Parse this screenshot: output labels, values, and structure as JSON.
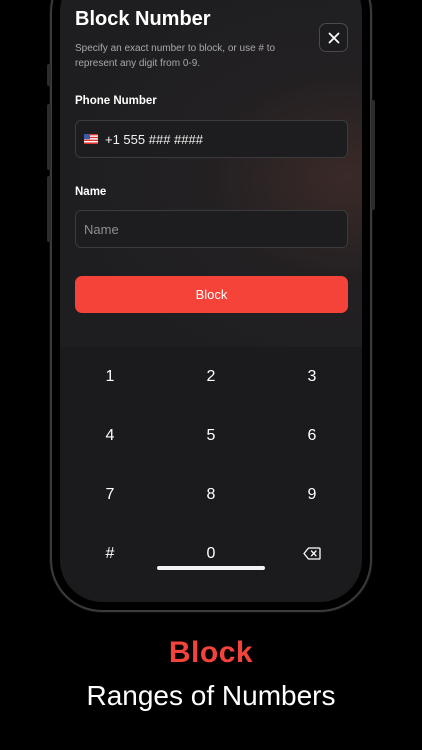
{
  "form": {
    "title": "Block Number",
    "subtitle": "Specify an exact number to block, or use # to represent any digit from 0-9.",
    "phone_label": "Phone Number",
    "phone_value": "+1 555 ### ####",
    "name_label": "Name",
    "name_placeholder": "Name",
    "name_value": "",
    "block_button": "Block"
  },
  "keypad": {
    "keys": [
      "1",
      "2",
      "3",
      "4",
      "5",
      "6",
      "7",
      "8",
      "9",
      "#",
      "0",
      "backspace"
    ]
  },
  "caption": {
    "headline": "Block",
    "subline": "Ranges of Numbers"
  },
  "colors": {
    "accent": "#f5433a",
    "background": "#000000",
    "sheet": "#1c1c1e"
  },
  "icons": {
    "close": "close-icon",
    "flag": "us-flag-icon",
    "backspace": "backspace-icon"
  }
}
